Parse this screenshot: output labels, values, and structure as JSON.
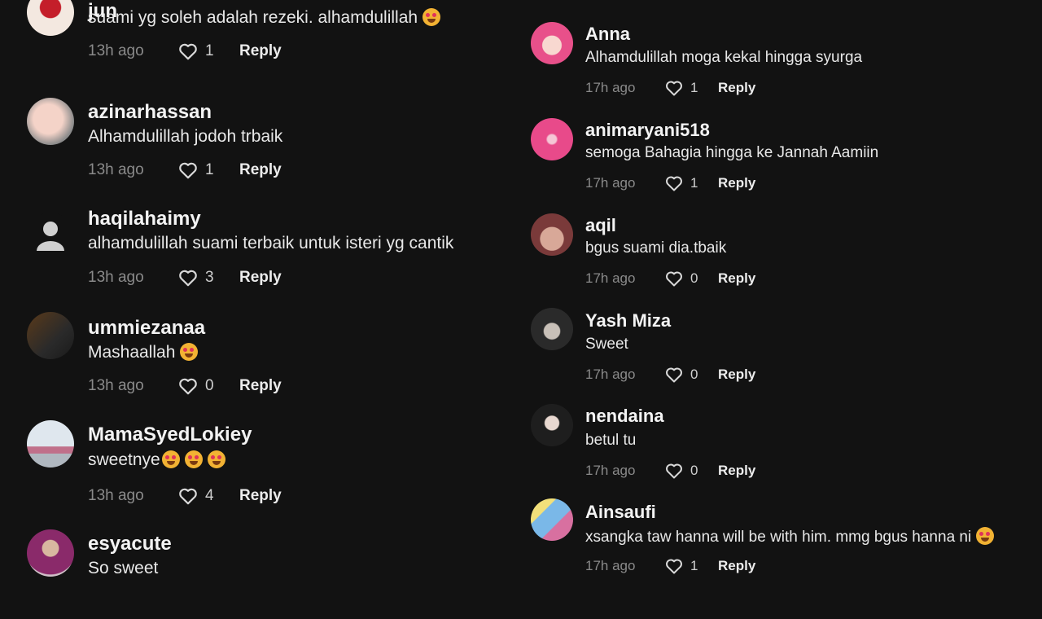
{
  "left_comments": [
    {
      "username": "jun",
      "text": "suami yg soleh adalah rezeki. alhamdulillah",
      "emoji_count": 1,
      "time": "13h ago",
      "likes": "1",
      "reply": "Reply",
      "avatar": "avatar-jun"
    },
    {
      "username": "azinarhassan",
      "text": "Alhamdulillah jodoh trbaik",
      "emoji_count": 0,
      "time": "13h ago",
      "likes": "1",
      "reply": "Reply",
      "avatar": "avatar-azinarhassan"
    },
    {
      "username": "haqilahaimy",
      "text": "alhamdulillah suami terbaik untuk isteri yg cantik",
      "emoji_count": 0,
      "time": "13h ago",
      "likes": "3",
      "reply": "Reply",
      "avatar": "default-avatar"
    },
    {
      "username": "ummiezanaa",
      "text": "Mashaallah",
      "emoji_count": 1,
      "time": "13h ago",
      "likes": "0",
      "reply": "Reply",
      "avatar": "avatar-ummiezanaa"
    },
    {
      "username": "MamaSyedLokiey",
      "text": "sweetnye",
      "emoji_count": 3,
      "time": "13h ago",
      "likes": "4",
      "reply": "Reply",
      "avatar": "avatar-mamasyedlokiey"
    },
    {
      "username": "esyacute",
      "text": "So sweet",
      "emoji_count": 0,
      "time": "",
      "likes": "",
      "reply": "",
      "avatar": "avatar-esyacute"
    }
  ],
  "right_comments": [
    {
      "username": "Anna",
      "text": "Alhamdulillah moga kekal hingga syurga",
      "emoji_count": 0,
      "time": "17h ago",
      "likes": "1",
      "reply": "Reply",
      "avatar": "avatar-anna"
    },
    {
      "username": "animaryani518",
      "text": "semoga Bahagia hingga ke Jannah Aamiin",
      "emoji_count": 0,
      "time": "17h ago",
      "likes": "1",
      "reply": "Reply",
      "avatar": "avatar-animaryani518"
    },
    {
      "username": "aqil",
      "text": "bgus suami dia.tbaik",
      "emoji_count": 0,
      "time": "17h ago",
      "likes": "0",
      "reply": "Reply",
      "avatar": "avatar-aqil"
    },
    {
      "username": "Yash Miza",
      "text": "Sweet",
      "emoji_count": 0,
      "time": "17h ago",
      "likes": "0",
      "reply": "Reply",
      "avatar": "avatar-yash-miza"
    },
    {
      "username": "nendaina",
      "text": "betul tu",
      "emoji_count": 0,
      "time": "17h ago",
      "likes": "0",
      "reply": "Reply",
      "avatar": "avatar-nendaina"
    },
    {
      "username": "Ainsaufi",
      "text": "xsangka taw hanna will be with him. mmg bgus hanna ni",
      "emoji_count": 1,
      "time": "17h ago",
      "likes": "1",
      "reply": "Reply",
      "avatar": "avatar-ainsaufi"
    }
  ],
  "colors": {
    "background": "#121212",
    "username": "#f3f3f3",
    "time": "#8a8a8a",
    "reply": "#ececec"
  },
  "icons": {
    "like": "heart-outline-icon",
    "emoji": "smiling-face-with-heart-eyes-emoji"
  }
}
